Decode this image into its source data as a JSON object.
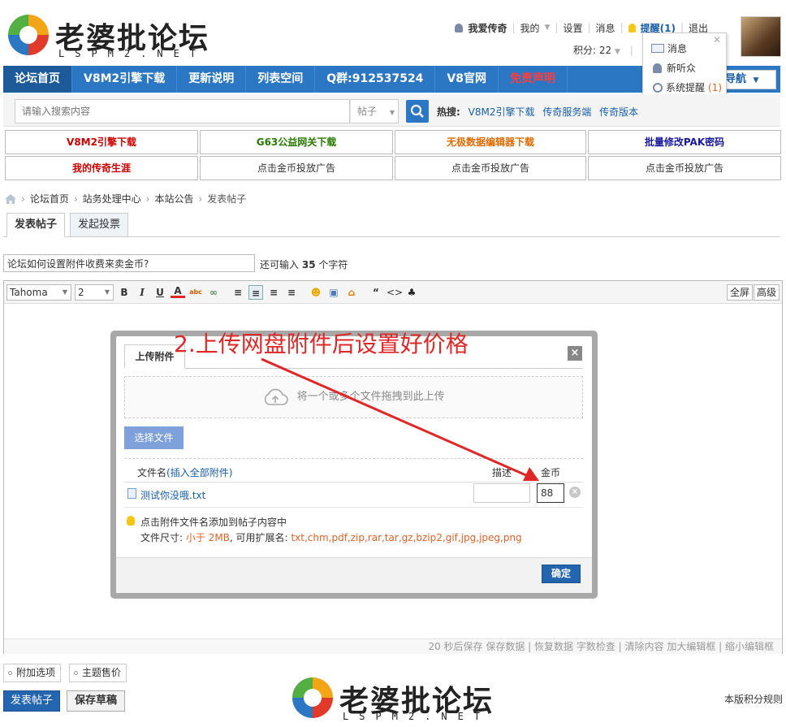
{
  "header": {
    "logo_text": "老婆批论坛",
    "logo_sub": "LSPM2.NET",
    "user_name": "我爱传奇",
    "my_label": "我的",
    "settings_label": "设置",
    "messages_label": "消息",
    "remind_label": "提醒(1)",
    "logout_label": "退出",
    "credits": "积分: 22"
  },
  "remind_popup": {
    "items": [
      "消息",
      "新听众",
      "系统提醒"
    ],
    "system_count": "(1)"
  },
  "nav": {
    "items": [
      "论坛首页",
      "V8M2引擎下载",
      "更新说明",
      "列表空间",
      "Q群:912537524",
      "V8官网",
      "免责声明"
    ],
    "dropdown": "导航"
  },
  "search": {
    "placeholder": "请输入搜索内容",
    "type": "帖子",
    "hot_label": "热搜:",
    "hot_items": [
      "V8M2引擎下载",
      "传奇服务端",
      "传奇版本"
    ]
  },
  "ads": {
    "row1": [
      "V8M2引擎下载",
      "G63公益网关下载",
      "无极数据编辑器下载",
      "批量修改PAK密码"
    ],
    "row2": [
      "我的传奇生涯",
      "点击金币投放广告",
      "点击金币投放广告",
      "点击金币投放广告"
    ],
    "colors": [
      "#cc0000",
      "#2a7a00",
      "#e06a00",
      "#1a1a9a"
    ]
  },
  "breadcrumb": [
    "论坛首页",
    "站务处理中心",
    "本站公告",
    "发表帖子"
  ],
  "tabs": [
    "发表帖子",
    "发起投票"
  ],
  "title_field": {
    "value": "论坛如何设置附件收费来卖金币?",
    "hint_prefix": "还可输入",
    "hint_count": "35",
    "hint_suffix": "个字符"
  },
  "toolbar": {
    "font": "Tahoma",
    "size": "2",
    "fullscreen": "全屏",
    "advanced": "高级"
  },
  "editor_status": "20 秒后保存 保存数据 | 恢复数据    字数检查 | 清除内容    加大编辑框 | 缩小编辑框",
  "dialog": {
    "tab": "上传附件",
    "dropzone": "将一个或多个文件拖拽到此上传",
    "select_button": "选择文件",
    "col_name": "文件名",
    "col_name_link": "插入全部附件",
    "col_desc": "描述",
    "col_gold": "金币",
    "file_name": "测试你没哦.txt",
    "gold_value": "88",
    "tip1": "点击附件文件名添加到帖子内容中",
    "tip2_prefix": "文件尺寸:",
    "tip2_size": "小于 2MB",
    "tip2_mid": ", 可用扩展名:",
    "tip2_ext": "txt,chm,pdf,zip,rar,tar,gz,bzip2,gif,jpg,jpeg,png",
    "confirm": "确定"
  },
  "annotation": "2.上传网盘附件后设置好价格",
  "bottom": {
    "extra_options": "附加选项",
    "theme_sale": "主题售价",
    "publish": "发表帖子",
    "draft": "保存草稿",
    "rules": "本版积分规则"
  },
  "colors": {
    "nav_blue": "#2b77c4",
    "annotation_red": "#e02727"
  }
}
